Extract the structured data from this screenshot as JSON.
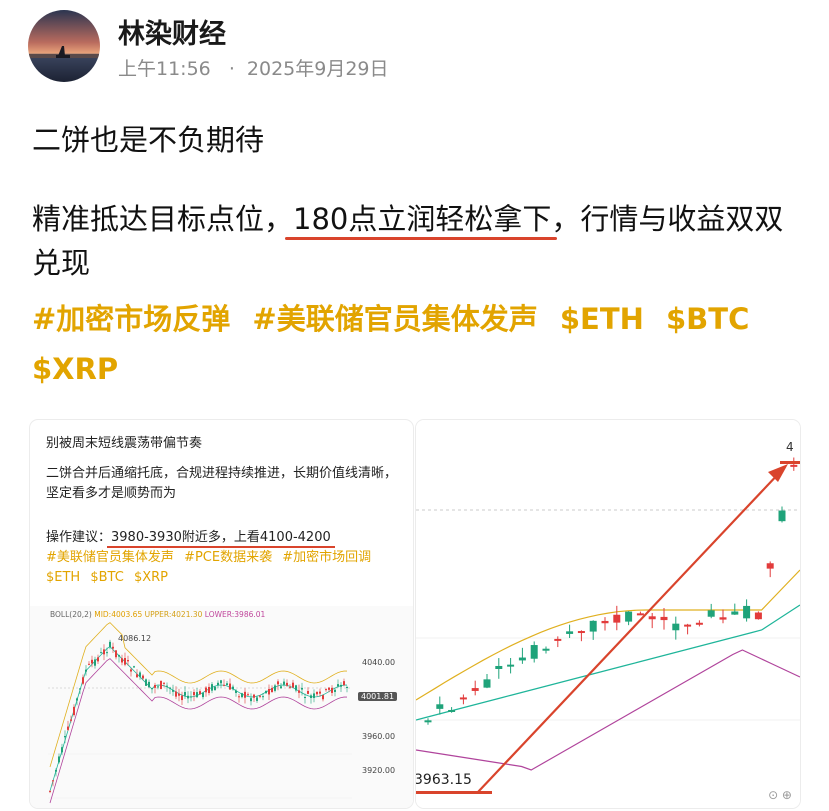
{
  "post": {
    "author": "林染财经",
    "time": "上午11:56",
    "separator": "·",
    "date": "2025年9月29日",
    "line1": "二饼也是不负期待",
    "line2_pre": "精准抵达目标点位，",
    "line2_underlined": "180点立润轻松拿下",
    "line2_post": "，行情与收益双双兑现",
    "tags": [
      "#加密市场反弹",
      "#美联储官员集体发声",
      "$ETH",
      "$BTC",
      "$XRP"
    ]
  },
  "card_left": {
    "title": "别被周末短线震荡带偏节奏",
    "body": "二饼合并后通缩托底，合规进程持续推进，长期价值线清晰，坚定看多才是顺势而为",
    "op_prefix": "操作建议：",
    "op_underlined": "3980-3930附近多，上看4100-4200",
    "tags": [
      "#美联储官员集体发声",
      "#PCE数据来袭",
      "#加密市场回调",
      "$ETH",
      "$BTC",
      "$XRP"
    ],
    "indicator": {
      "name": "BOLL(20,2)",
      "mid": "MID:4003.65",
      "upper": "UPPER:4021.30",
      "lower": "LOWER:3986.01"
    },
    "high_label": "4086.12",
    "price_levels": [
      "4040.00",
      "3960.00",
      "3920.00"
    ],
    "current_price": "4001.81"
  },
  "card_right": {
    "low_label": "3963.15",
    "top_label": "4",
    "icons": "⊙ ⊕"
  },
  "colors": {
    "accent": "#d9442c",
    "tag": "#e2a400",
    "up": "#1fa37a",
    "down": "#e23b3b",
    "boll_upper": "#e0b020",
    "boll_mid": "#1fb59a",
    "boll_lower": "#b0449c"
  }
}
